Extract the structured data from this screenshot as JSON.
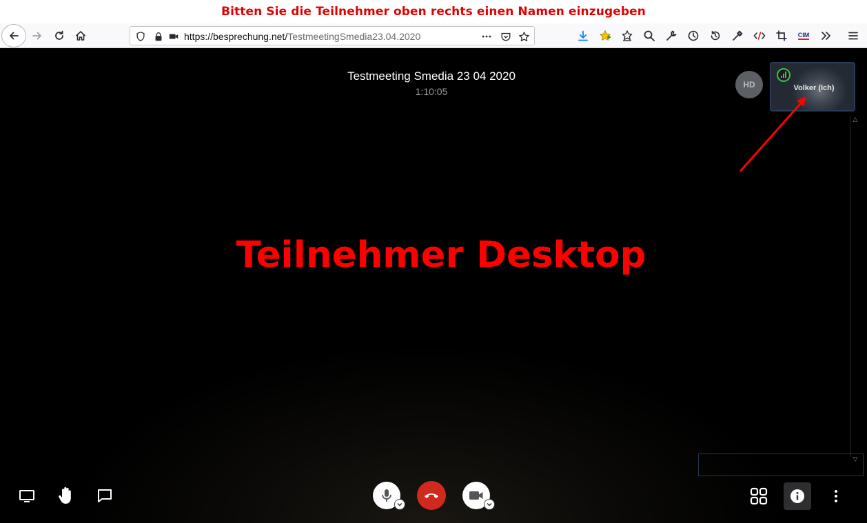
{
  "annotation": {
    "banner_text": "Bitten Sie die Teilnehmer oben rechts einen Namen einzugeben",
    "desktop_label": "Teilnehmer Desktop"
  },
  "browser": {
    "url_host": "https://besprechung.net/",
    "url_path": "TestmeetingSmedia23.04.2020",
    "icons": [
      "back-icon",
      "forward-icon",
      "reload-icon",
      "home-icon",
      "shield-icon",
      "lock-icon",
      "camera-permission-icon",
      "page-actions-icon",
      "pocket-icon",
      "bookmark-star-icon",
      "download-icon",
      "addon-star-icon",
      "bookmarks-icon",
      "search-icon",
      "wrench-icon",
      "history-icon",
      "restore-icon",
      "eyedropper-icon",
      "devtools-icon",
      "crop-icon",
      "cim-icon",
      "overflow-icon",
      "menu-icon"
    ],
    "cim_label": "CIM",
    "accent": "#0a84ff"
  },
  "meeting": {
    "title": "Testmeeting Smedia 23 04 2020",
    "timer": "1:10:05",
    "quality_badge": "HD",
    "local_participant": "Volker (Ich)"
  },
  "controls": {
    "left": [
      "screen-share-icon",
      "raise-hand-icon",
      "chat-icon"
    ],
    "center": [
      "microphone-icon",
      "hangup-icon",
      "camera-icon"
    ],
    "right": [
      "tile-view-icon",
      "info-icon",
      "more-icon"
    ],
    "hangup_color": "#d2291e"
  },
  "colors": {
    "annotation_red": "#ff0000",
    "signal_green": "#3fbf4f"
  }
}
